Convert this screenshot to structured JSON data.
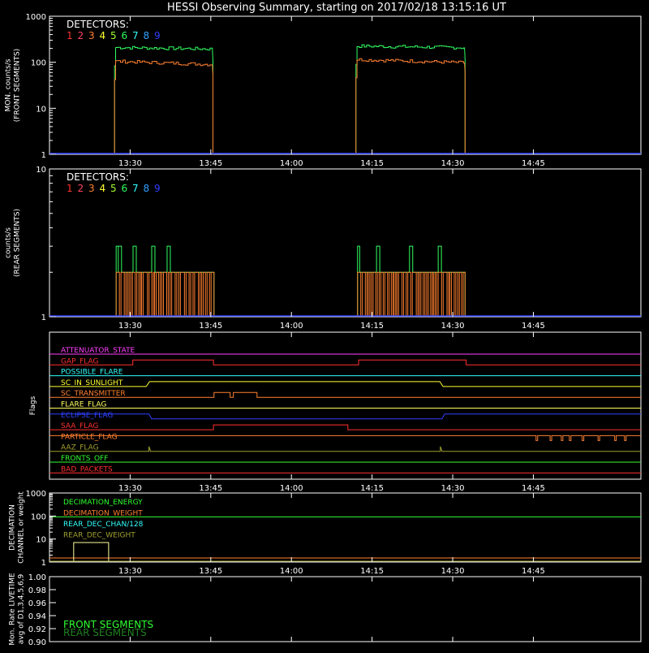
{
  "title": "HESSI Observing Summary, starting on 2017/02/18 13:15:16 UT",
  "colors": {
    "background": "#000000",
    "axis": "#ffffff",
    "det": [
      "#ff3030",
      "#ff4060",
      "#ff8030",
      "#ffff30",
      "#a0ff30",
      "#30ff60",
      "#30ffff",
      "#30a0ff",
      "#3040ff"
    ],
    "front_green": "#3ce040",
    "front_orange": "#ff8c3c",
    "baseline_blue": "#2030ff"
  },
  "chart_data": [
    {
      "type": "line",
      "name": "front",
      "title": "",
      "ylabel": [
        "MON. counts/s",
        "(FRONT SEGMENTS)"
      ],
      "xlabel": "",
      "ylog": true,
      "ylim": [
        1,
        1000
      ],
      "ytick_labels": [
        "1",
        "10",
        "100",
        "1000"
      ],
      "ytick_values": [
        1,
        10,
        100,
        1000
      ],
      "x_range_min": [
        0,
        180
      ],
      "xtick_labels": [
        "13:30",
        "13:45",
        "14:00",
        "14:15",
        "14:30",
        "14:45"
      ],
      "xtick_values": [
        15,
        30,
        45,
        60,
        75,
        90
      ],
      "legend_title": "DETECTORS:",
      "legend_items": [
        "1",
        "2",
        "3",
        "4",
        "5",
        "6",
        "7",
        "8",
        "9"
      ],
      "series": [
        {
          "color_index": 5,
          "segments": [
            {
              "start": 12.1,
              "end": 30.4,
              "level": 210
            },
            {
              "start": 57.0,
              "end": 77.3,
              "level": 225
            }
          ]
        },
        {
          "color_index": 2,
          "segments": [
            {
              "start": 12.1,
              "end": 30.4,
              "level": 105
            },
            {
              "start": 57.0,
              "end": 77.3,
              "level": 115
            }
          ]
        },
        {
          "color_index": 8,
          "segments": [
            {
              "start": 0,
              "end": 100,
              "level": 1
            }
          ]
        }
      ]
    },
    {
      "type": "line",
      "name": "rear",
      "ylabel": [
        "counts/s",
        "(REAR SEGMENTS)"
      ],
      "xlabel": "",
      "ylog": true,
      "ylim": [
        1,
        10
      ],
      "ytick_labels": [
        "1",
        "10"
      ],
      "ytick_values": [
        1,
        10
      ],
      "xtick_labels": [
        "13:30",
        "13:45",
        "14:00",
        "14:15",
        "14:30",
        "14:45"
      ],
      "xtick_values": [
        15,
        30,
        45,
        60,
        75,
        90
      ],
      "legend_title": "DETECTORS:",
      "legend_items": [
        "1",
        "2",
        "3",
        "4",
        "5",
        "6",
        "7",
        "8",
        "9"
      ],
      "series": [
        {
          "color_index": 5,
          "segments": [
            {
              "start": 12.4,
              "end": 30.6,
              "level": 2
            },
            {
              "start": 57.3,
              "end": 77.3,
              "level": 2
            }
          ]
        },
        {
          "color_index": 2,
          "segments": [
            {
              "start": 12.4,
              "end": 30.6,
              "level": 2
            },
            {
              "start": 57.3,
              "end": 77.3,
              "level": 2
            }
          ]
        },
        {
          "color_index": 8,
          "segments": [
            {
              "start": 0,
              "end": 100,
              "level": 1
            }
          ]
        }
      ]
    },
    {
      "type": "line",
      "name": "flags",
      "ylabel": [
        "Flags"
      ],
      "xtick_labels": [
        "13:30",
        "13:45",
        "14:00",
        "14:15",
        "14:30",
        "14:45"
      ],
      "xtick_values": [
        15,
        30,
        45,
        60,
        75,
        90
      ],
      "flags": [
        {
          "label": "ATTENUATOR_STATE",
          "color": "#ff40ff"
        },
        {
          "label": "GAP_FLAG",
          "color": "#ff3030"
        },
        {
          "label": "POSSIBLE_FLARE",
          "color": "#30ffff"
        },
        {
          "label": "SC_IN_SUNLIGHT",
          "color": "#ffff30"
        },
        {
          "label": "SC_TRANSMITTER",
          "color": "#ff8030"
        },
        {
          "label": "FLARE_FLAG",
          "color": "#ffff60"
        },
        {
          "label": "ECLIPSE_FLAG",
          "color": "#3040ff"
        },
        {
          "label": "SAA_FLAG",
          "color": "#ff3030"
        },
        {
          "label": "PARTICLE_FLAG",
          "color": "#ff8030"
        },
        {
          "label": "AAZ_FLAG",
          "color": "#a0a030"
        },
        {
          "label": "FRONTS_OFF",
          "color": "#30ff30"
        },
        {
          "label": "BAD_PACKETS",
          "color": "#ff3030"
        }
      ]
    },
    {
      "type": "line",
      "name": "decimation",
      "ylabel": [
        "DECIMATION",
        "CHANNEL or weight"
      ],
      "ylog": true,
      "ylim": [
        1,
        1000
      ],
      "ytick_labels": [
        "1",
        "10",
        "100",
        "1000"
      ],
      "ytick_values": [
        1,
        10,
        100,
        1000
      ],
      "xtick_labels": [
        "13:30",
        "13:45",
        "14:00",
        "14:15",
        "14:30",
        "14:45"
      ],
      "xtick_values": [
        15,
        30,
        45,
        60,
        75,
        90
      ],
      "legend_items": [
        {
          "label": "DECIMATION_ENERGY",
          "color": "#30ff30"
        },
        {
          "label": "DECIMATION_WEIGHT",
          "color": "#ff8030"
        },
        {
          "label": "REAR_DEC_CHAN/128",
          "color": "#30ffff"
        },
        {
          "label": "REAR_DEC_WEIGHT",
          "color": "#a0a030"
        }
      ]
    },
    {
      "type": "line",
      "name": "livetime",
      "ylabel": [
        "Mon. Rate LIVETIME",
        "avg of D1,3,4,5,6,9"
      ],
      "ylim": [
        0.9,
        1.0
      ],
      "ytick_labels": [
        "0.90",
        "0.92",
        "0.94",
        "0.96",
        "0.98",
        "1.00"
      ],
      "ytick_values": [
        0.9,
        0.92,
        0.94,
        0.96,
        0.98,
        1.0
      ],
      "legend_items": [
        {
          "label": "FRONT SEGMENTS",
          "color": "#30ff30"
        },
        {
          "label": "REAR SEGMENTS",
          "color": "#208020"
        }
      ]
    }
  ]
}
